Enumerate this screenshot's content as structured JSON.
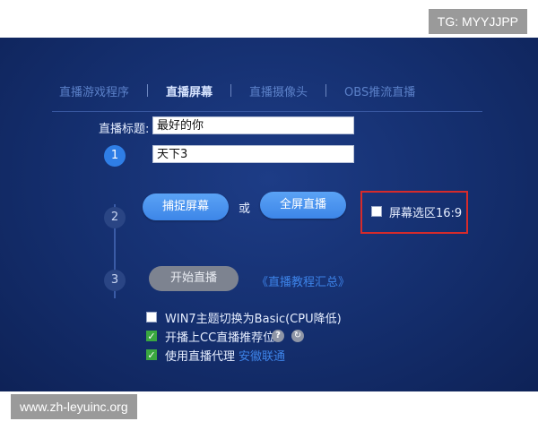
{
  "watermarks": {
    "top": "TG: MYYJJPP",
    "bottom": "www.zh-leyuinc.org"
  },
  "tabs": [
    {
      "label": "直播游戏程序",
      "active": false
    },
    {
      "label": "直播屏幕",
      "active": true
    },
    {
      "label": "直播摄像头",
      "active": false
    },
    {
      "label": "OBS推流直播",
      "active": false
    }
  ],
  "form": {
    "title_label": "直播标题:",
    "title_value": "最好的你",
    "category_value": "天下3"
  },
  "steps": [
    "1",
    "2",
    "3"
  ],
  "capture": {
    "capture_screen_label": "捕捉屏幕",
    "or_text": "或",
    "fullscreen_label": "全屏直播",
    "ratio_label": "屏幕选区16:9",
    "ratio_checked": false
  },
  "start": {
    "start_label": "开始直播",
    "tutorial_link": "《直播教程汇总》"
  },
  "options": [
    {
      "label": "WIN7主题切换为Basic(CPU降低)",
      "checked": false
    },
    {
      "label": "开播上CC直播推荐位",
      "checked": true
    },
    {
      "label": "使用直播代理",
      "checked": true,
      "link": "安徽联通"
    }
  ],
  "icons": {
    "help": "?",
    "refresh": "↻",
    "check": "✓"
  },
  "colors": {
    "panel_bg": "#142e6d",
    "accent_blue": "#3d86e8",
    "check_green": "#3aa840",
    "highlight_red": "#d62b2b"
  }
}
